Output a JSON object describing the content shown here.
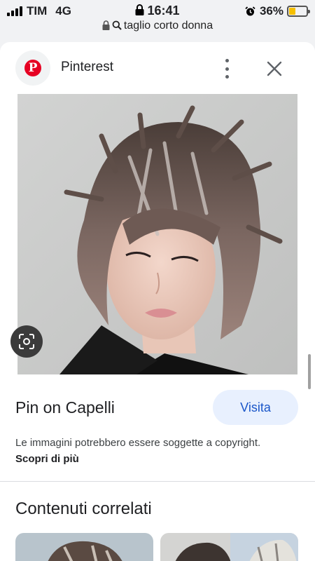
{
  "status_bar": {
    "carrier": "TIM",
    "network": "4G",
    "time": "16:41",
    "battery": "36%",
    "battery_level": 0.36
  },
  "url_bar": {
    "query": "taglio corto donna"
  },
  "header": {
    "site_name": "Pinterest",
    "favicon_letter": "P",
    "brand_color": "#e60023"
  },
  "image": {
    "description_icon": "lens-icon"
  },
  "result": {
    "title": "Pin on Capelli",
    "visit_label": "Visita",
    "copyright_text": "Le immagini potrebbero essere soggette a copyright.",
    "learn_more": "Scopri di più"
  },
  "related": {
    "heading": "Contenuti correlati"
  },
  "colors": {
    "accent": "#1a56c9",
    "visit_bg": "#e8f0fe"
  }
}
